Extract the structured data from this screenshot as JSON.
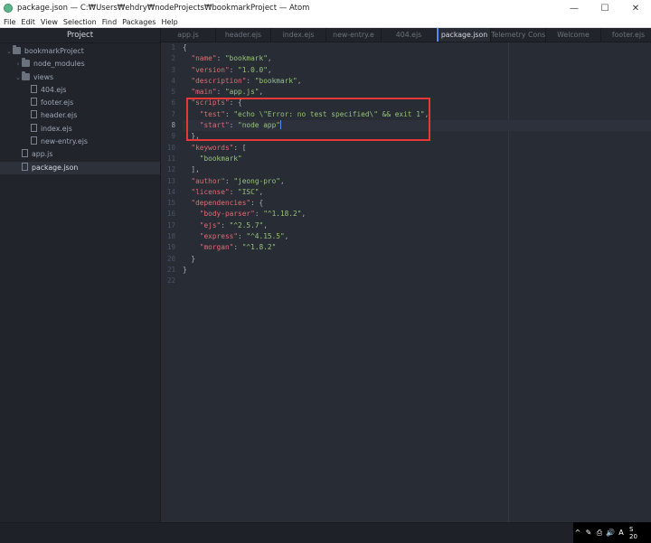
{
  "window": {
    "title": "package.json — C:₩Users₩ehdry₩nodeProjects₩bookmarkProject — Atom",
    "minimize": "—",
    "maximize": "☐",
    "close": "✕"
  },
  "menu": [
    "File",
    "Edit",
    "View",
    "Selection",
    "Find",
    "Packages",
    "Help"
  ],
  "tree": {
    "header": "Project",
    "items": [
      {
        "label": "bookmarkProject",
        "kind": "folder",
        "depth": 0,
        "expanded": true
      },
      {
        "label": "node_modules",
        "kind": "folder",
        "depth": 1,
        "expanded": false
      },
      {
        "label": "views",
        "kind": "folder",
        "depth": 1,
        "expanded": true
      },
      {
        "label": "404.ejs",
        "kind": "file",
        "depth": 2
      },
      {
        "label": "footer.ejs",
        "kind": "file",
        "depth": 2
      },
      {
        "label": "header.ejs",
        "kind": "file",
        "depth": 2
      },
      {
        "label": "index.ejs",
        "kind": "file",
        "depth": 2
      },
      {
        "label": "new-entry.ejs",
        "kind": "file",
        "depth": 2
      },
      {
        "label": "app.js",
        "kind": "file",
        "depth": 1
      },
      {
        "label": "package.json",
        "kind": "file",
        "depth": 1,
        "selected": true
      }
    ]
  },
  "tabs": [
    {
      "label": "app.js"
    },
    {
      "label": "header.ejs"
    },
    {
      "label": "index.ejs"
    },
    {
      "label": "new-entry.e"
    },
    {
      "label": "404.ejs"
    },
    {
      "label": "package.json",
      "active": true
    },
    {
      "label": "Telemetry Cons"
    },
    {
      "label": "Welcome"
    },
    {
      "label": "footer.ejs"
    }
  ],
  "editor": {
    "current_line": 8,
    "lines": [
      [
        [
          "p",
          "{"
        ]
      ],
      [
        [
          "p",
          "  "
        ],
        [
          "k",
          "\"name\""
        ],
        [
          "p",
          ": "
        ],
        [
          "s",
          "\"bookmark\""
        ],
        [
          "p",
          ","
        ]
      ],
      [
        [
          "p",
          "  "
        ],
        [
          "k",
          "\"version\""
        ],
        [
          "p",
          ": "
        ],
        [
          "s",
          "\"1.0.0\""
        ],
        [
          "p",
          ","
        ]
      ],
      [
        [
          "p",
          "  "
        ],
        [
          "k",
          "\"description\""
        ],
        [
          "p",
          ": "
        ],
        [
          "s",
          "\"bookmark\""
        ],
        [
          "p",
          ","
        ]
      ],
      [
        [
          "p",
          "  "
        ],
        [
          "k",
          "\"main\""
        ],
        [
          "p",
          ": "
        ],
        [
          "s",
          "\"app.js\""
        ],
        [
          "p",
          ","
        ]
      ],
      [
        [
          "p",
          "  "
        ],
        [
          "k",
          "\"scripts\""
        ],
        [
          "p",
          ": {"
        ]
      ],
      [
        [
          "p",
          "    "
        ],
        [
          "k",
          "\"test\""
        ],
        [
          "p",
          ": "
        ],
        [
          "s",
          "\"echo \\\"Error: no test specified\\\" && exit 1\""
        ],
        [
          "p",
          ","
        ]
      ],
      [
        [
          "p",
          "    "
        ],
        [
          "k",
          "\"start\""
        ],
        [
          "p",
          ": "
        ],
        [
          "s",
          "\"node app\""
        ]
      ],
      [
        [
          "p",
          "  },"
        ]
      ],
      [
        [
          "p",
          "  "
        ],
        [
          "k",
          "\"keywords\""
        ],
        [
          "p",
          ": ["
        ]
      ],
      [
        [
          "p",
          "    "
        ],
        [
          "s",
          "\"bookmark\""
        ]
      ],
      [
        [
          "p",
          "  ],"
        ]
      ],
      [
        [
          "p",
          "  "
        ],
        [
          "k",
          "\"author\""
        ],
        [
          "p",
          ": "
        ],
        [
          "s",
          "\"jeong-pro\""
        ],
        [
          "p",
          ","
        ]
      ],
      [
        [
          "p",
          "  "
        ],
        [
          "k",
          "\"license\""
        ],
        [
          "p",
          ": "
        ],
        [
          "s",
          "\"ISC\""
        ],
        [
          "p",
          ","
        ]
      ],
      [
        [
          "p",
          "  "
        ],
        [
          "k",
          "\"dependencies\""
        ],
        [
          "p",
          ": {"
        ]
      ],
      [
        [
          "p",
          "    "
        ],
        [
          "k",
          "\"body-parser\""
        ],
        [
          "p",
          ": "
        ],
        [
          "s",
          "\"^1.18.2\""
        ],
        [
          "p",
          ","
        ]
      ],
      [
        [
          "p",
          "    "
        ],
        [
          "k",
          "\"ejs\""
        ],
        [
          "p",
          ": "
        ],
        [
          "s",
          "\"^2.5.7\""
        ],
        [
          "p",
          ","
        ]
      ],
      [
        [
          "p",
          "    "
        ],
        [
          "k",
          "\"express\""
        ],
        [
          "p",
          ": "
        ],
        [
          "s",
          "\"^4.15.5\""
        ],
        [
          "p",
          ","
        ]
      ],
      [
        [
          "p",
          "    "
        ],
        [
          "k",
          "\"morgan\""
        ],
        [
          "p",
          ": "
        ],
        [
          "s",
          "\"^1.8.2\""
        ]
      ],
      [
        [
          "p",
          "  }"
        ]
      ],
      [
        [
          "p",
          "}"
        ]
      ],
      [
        [
          "p",
          ""
        ]
      ]
    ]
  },
  "taskbar": {
    "icons": [
      "^",
      "✎",
      "⎙",
      "🔊",
      "A"
    ],
    "clock": [
      "S",
      "20"
    ]
  },
  "colors": {
    "accent": "#568af2",
    "highlight_box": "#e53935",
    "json_key": "#e06c75",
    "json_string": "#98c379"
  }
}
